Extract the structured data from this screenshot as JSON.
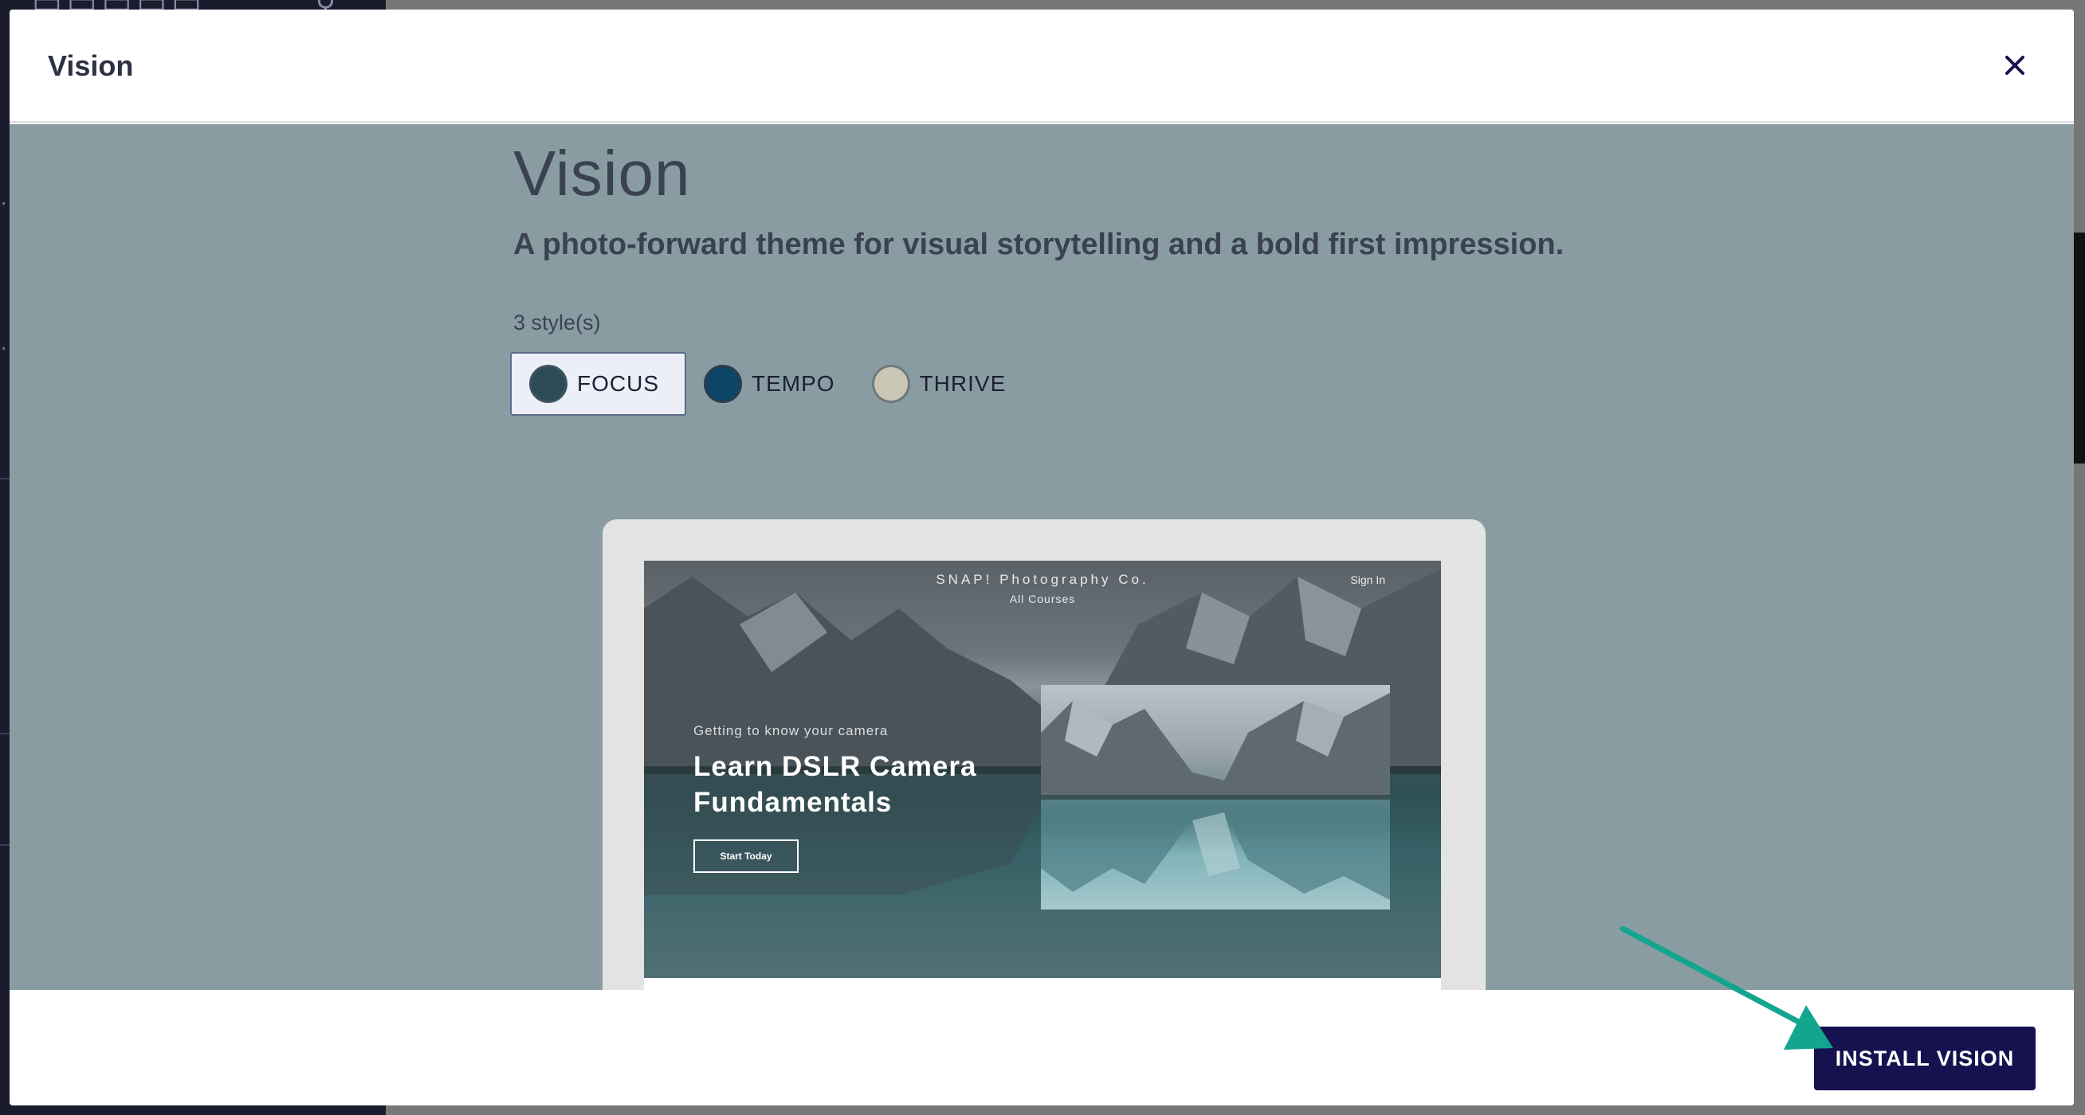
{
  "modal": {
    "title": "Vision",
    "close_icon": "close-icon"
  },
  "theme": {
    "name": "Vision",
    "description": "A photo-forward theme for visual storytelling and a bold first impression.",
    "style_count": "3 style(s)",
    "styles": [
      {
        "label": "FOCUS",
        "color": "#2d4a55",
        "selected": true
      },
      {
        "label": "TEMPO",
        "color": "#0d4566",
        "selected": false
      },
      {
        "label": "THRIVE",
        "color": "#c9c6b4",
        "selected": false
      }
    ]
  },
  "preview": {
    "brand": "SNAP! Photography Co.",
    "nav_courses": "All Courses",
    "sign_in": "Sign In",
    "eyebrow": "Getting to know your camera",
    "headline": "Learn DSLR Camera Fundamentals",
    "cta": "Start Today"
  },
  "footer": {
    "install_label": "INSTALL VISION"
  },
  "colors": {
    "accent": "#161250",
    "modal_body_bg": "#899ca2",
    "arrow": "#14a58e"
  }
}
